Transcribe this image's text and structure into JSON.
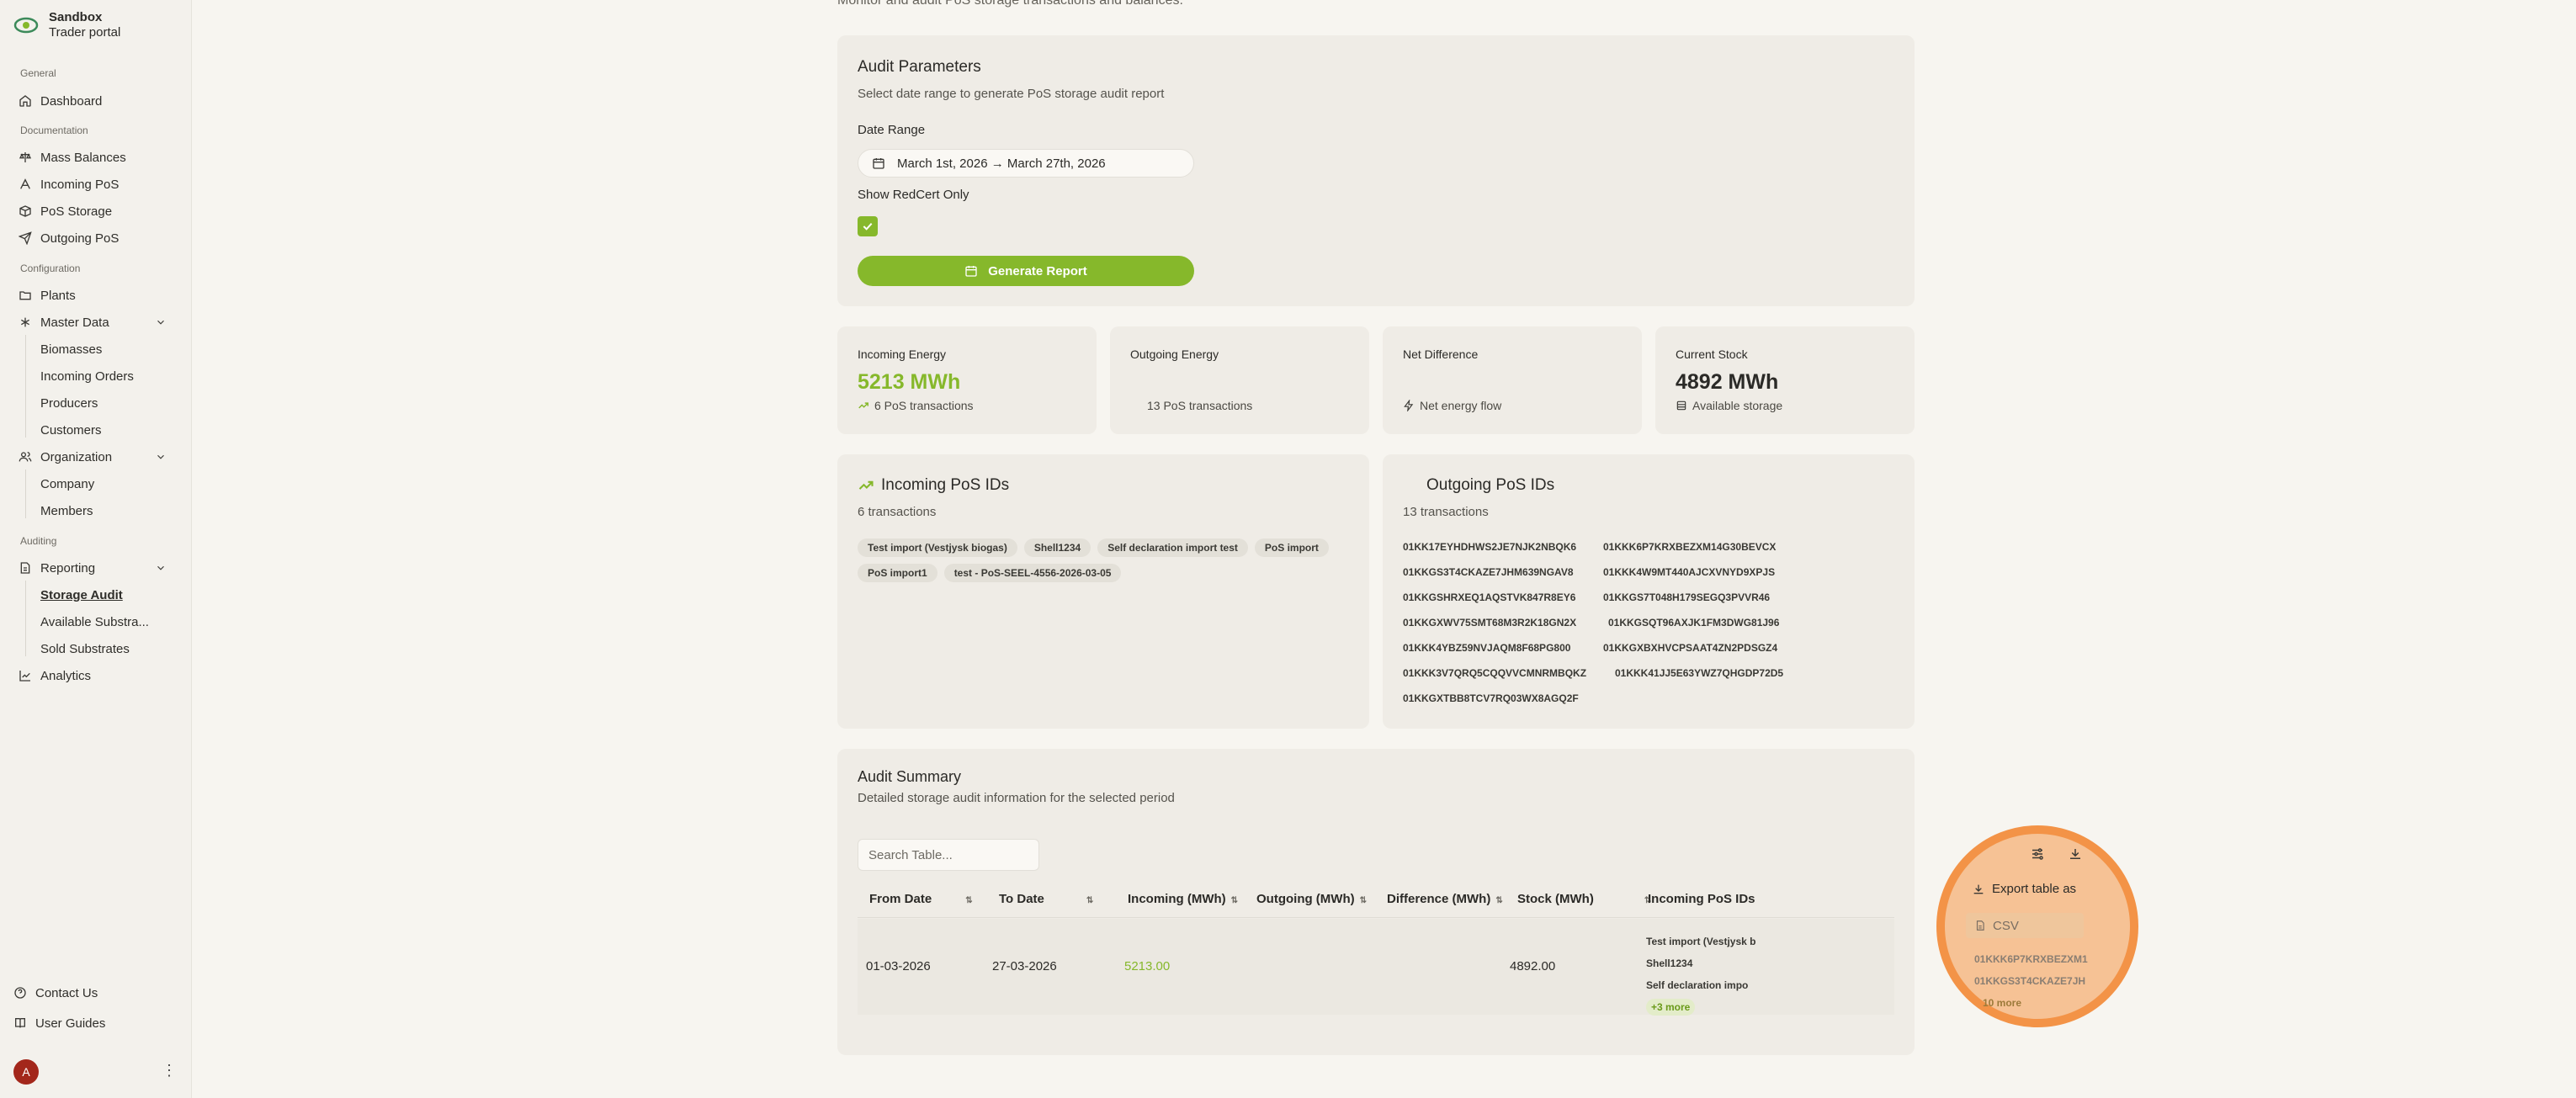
{
  "brand": {
    "name": "Sandbox",
    "sub": "Trader portal"
  },
  "sidebar": {
    "sections": {
      "general": "General",
      "documentation": "Documentation",
      "configuration": "Configuration",
      "auditing": "Auditing"
    },
    "items": {
      "dashboard": "Dashboard",
      "mass_balances": "Mass Balances",
      "incoming_pos": "Incoming PoS",
      "pos_storage": "PoS Storage",
      "outgoing_pos": "Outgoing PoS",
      "plants": "Plants",
      "master_data": "Master Data",
      "biomasses": "Biomasses",
      "incoming_orders": "Incoming Orders",
      "producers": "Producers",
      "customers": "Customers",
      "organization": "Organization",
      "company": "Company",
      "members": "Members",
      "reporting": "Reporting",
      "storage_audit": "Storage Audit",
      "available_substrates": "Available Substra...",
      "sold_substrates": "Sold Substrates",
      "analytics": "Analytics",
      "contact_us": "Contact Us",
      "user_guides": "User Guides"
    },
    "avatar": "A"
  },
  "page": {
    "subtitle": "Monitor and audit PoS storage transactions and balances."
  },
  "params": {
    "title": "Audit Parameters",
    "description": "Select date range to generate PoS storage audit report",
    "date_label": "Date Range",
    "date_value": "March 1st, 2026 → March 27th, 2026",
    "redcert_label": "Show RedCert Only",
    "redcert_checked": true,
    "generate_label": "Generate Report"
  },
  "stats": {
    "incoming": {
      "label": "Incoming Energy",
      "value": "5213 MWh",
      "foot": "6 PoS transactions"
    },
    "outgoing": {
      "label": "Outgoing Energy",
      "value": "",
      "foot": "13 PoS transactions"
    },
    "net": {
      "label": "Net Difference",
      "value": "",
      "foot": "Net energy flow"
    },
    "stock": {
      "label": "Current Stock",
      "value": "4892 MWh",
      "foot": "Available storage"
    }
  },
  "incoming_ids": {
    "title": "Incoming PoS IDs",
    "count": "6 transactions",
    "tags": [
      "Test import (Vestjysk biogas)",
      "Shell1234",
      "Self declaration import test",
      "PoS import",
      "PoS import1",
      "test - PoS-SEEL-4556-2026-03-05"
    ]
  },
  "outgoing_ids": {
    "title": "Outgoing PoS IDs",
    "count": "13 transactions",
    "ids": [
      [
        "01KK17EYHDHWS2JE7NJK2NBQK6",
        "01KKK6P7KRXBEZXM14G30BEVCX"
      ],
      [
        "01KKGS3T4CKAZE7JHM639NGAV8",
        "01KKK4W9MT440AJCXVNYD9XPJS"
      ],
      [
        "01KKGSHRXEQ1AQSTVK847R8EY6",
        "01KKGS7T048H179SEGQ3PVVR46"
      ],
      [
        "01KKGXWV75SMT68M3R2K18GN2X",
        "01KKGSQT96AXJK1FM3DWG81J96"
      ],
      [
        "01KKK4YBZ59NVJAQM8F68PG800",
        "01KKGXBXHVCPSAAT4ZN2PDSGZ4"
      ],
      [
        "01KKK3V7QRQ5CQQVVCMNRMBQKZ",
        "01KKK41JJ5E63YWZ7QHGDP72D5"
      ],
      [
        "01KKGXTBB8TCV7RQ03WX8AGQ2F",
        ""
      ]
    ]
  },
  "summary": {
    "title": "Audit Summary",
    "description": "Detailed storage audit information for the selected period",
    "search_placeholder": "Search Table...",
    "columns": [
      "From Date",
      "To Date",
      "Incoming (MWh)",
      "Outgoing (MWh)",
      "Difference (MWh)",
      "Stock (MWh)",
      "Incoming PoS IDs"
    ],
    "row": {
      "from": "01-03-2026",
      "to": "27-03-2026",
      "incoming": "5213.00",
      "outgoing": "",
      "difference": "",
      "stock": "4892.00",
      "incoming_ids": [
        "Test import (Vestjysk b",
        "Shell1234",
        "Self declaration impo"
      ],
      "incoming_more": "+3 more",
      "outgoing_ids": [
        "01KKK6P7KRXBEZXM1",
        "01KKGS3T4CKAZE7JH"
      ],
      "outgoing_more": "10 more"
    },
    "export": {
      "title": "Export table as",
      "csv": "CSV"
    }
  },
  "colors": {
    "accent": "#86b82b",
    "highlight": "#f39347"
  }
}
